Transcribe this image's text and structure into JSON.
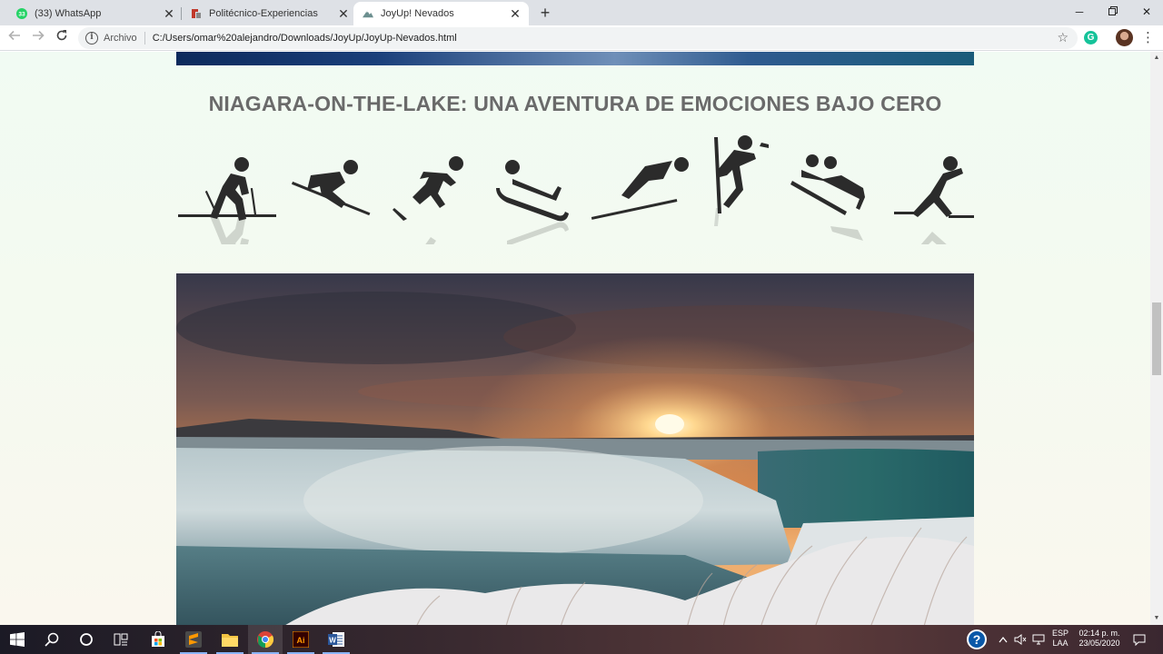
{
  "browser": {
    "tabs": [
      {
        "title": "(33) WhatsApp",
        "badge": "33",
        "active": false
      },
      {
        "title": "Politécnico-Experiencias",
        "active": false
      },
      {
        "title": "JoyUp! Nevados",
        "active": true
      }
    ],
    "address_bar": {
      "security_label": "Archivo",
      "url": "C:/Users/omar%20alejandro/Downloads/JoyUp/JoyUp-Nevados.html"
    },
    "extension_letter": "G"
  },
  "page": {
    "heading": "NIAGARA-ON-THE-LAKE: UNA AVENTURA DE EMOCIONES BAJO CERO",
    "sport_icons": [
      "cross-country-skiing-icon",
      "alpine-skiing-icon",
      "speed-skating-icon",
      "luge-icon",
      "ski-jumping-icon",
      "snowboard-icon",
      "bobsleigh-icon",
      "figure-skating-icon"
    ],
    "photo_subject": "Niagara Falls at sunset in winter"
  },
  "taskbar": {
    "language": "ESP",
    "layout": "LAA",
    "time": "02:14 p. m.",
    "date": "23/05/2020",
    "apps": [
      "start",
      "search",
      "cortana",
      "task-view",
      "store",
      "sublime-text",
      "file-explorer",
      "chrome",
      "illustrator",
      "word"
    ]
  },
  "colors": {
    "tabstrip": "#dee1e6",
    "heading": "#6a6a6a",
    "icon": "#2b2b2b",
    "page_bg": "#f1fbf3",
    "whatsapp": "#25d366"
  }
}
